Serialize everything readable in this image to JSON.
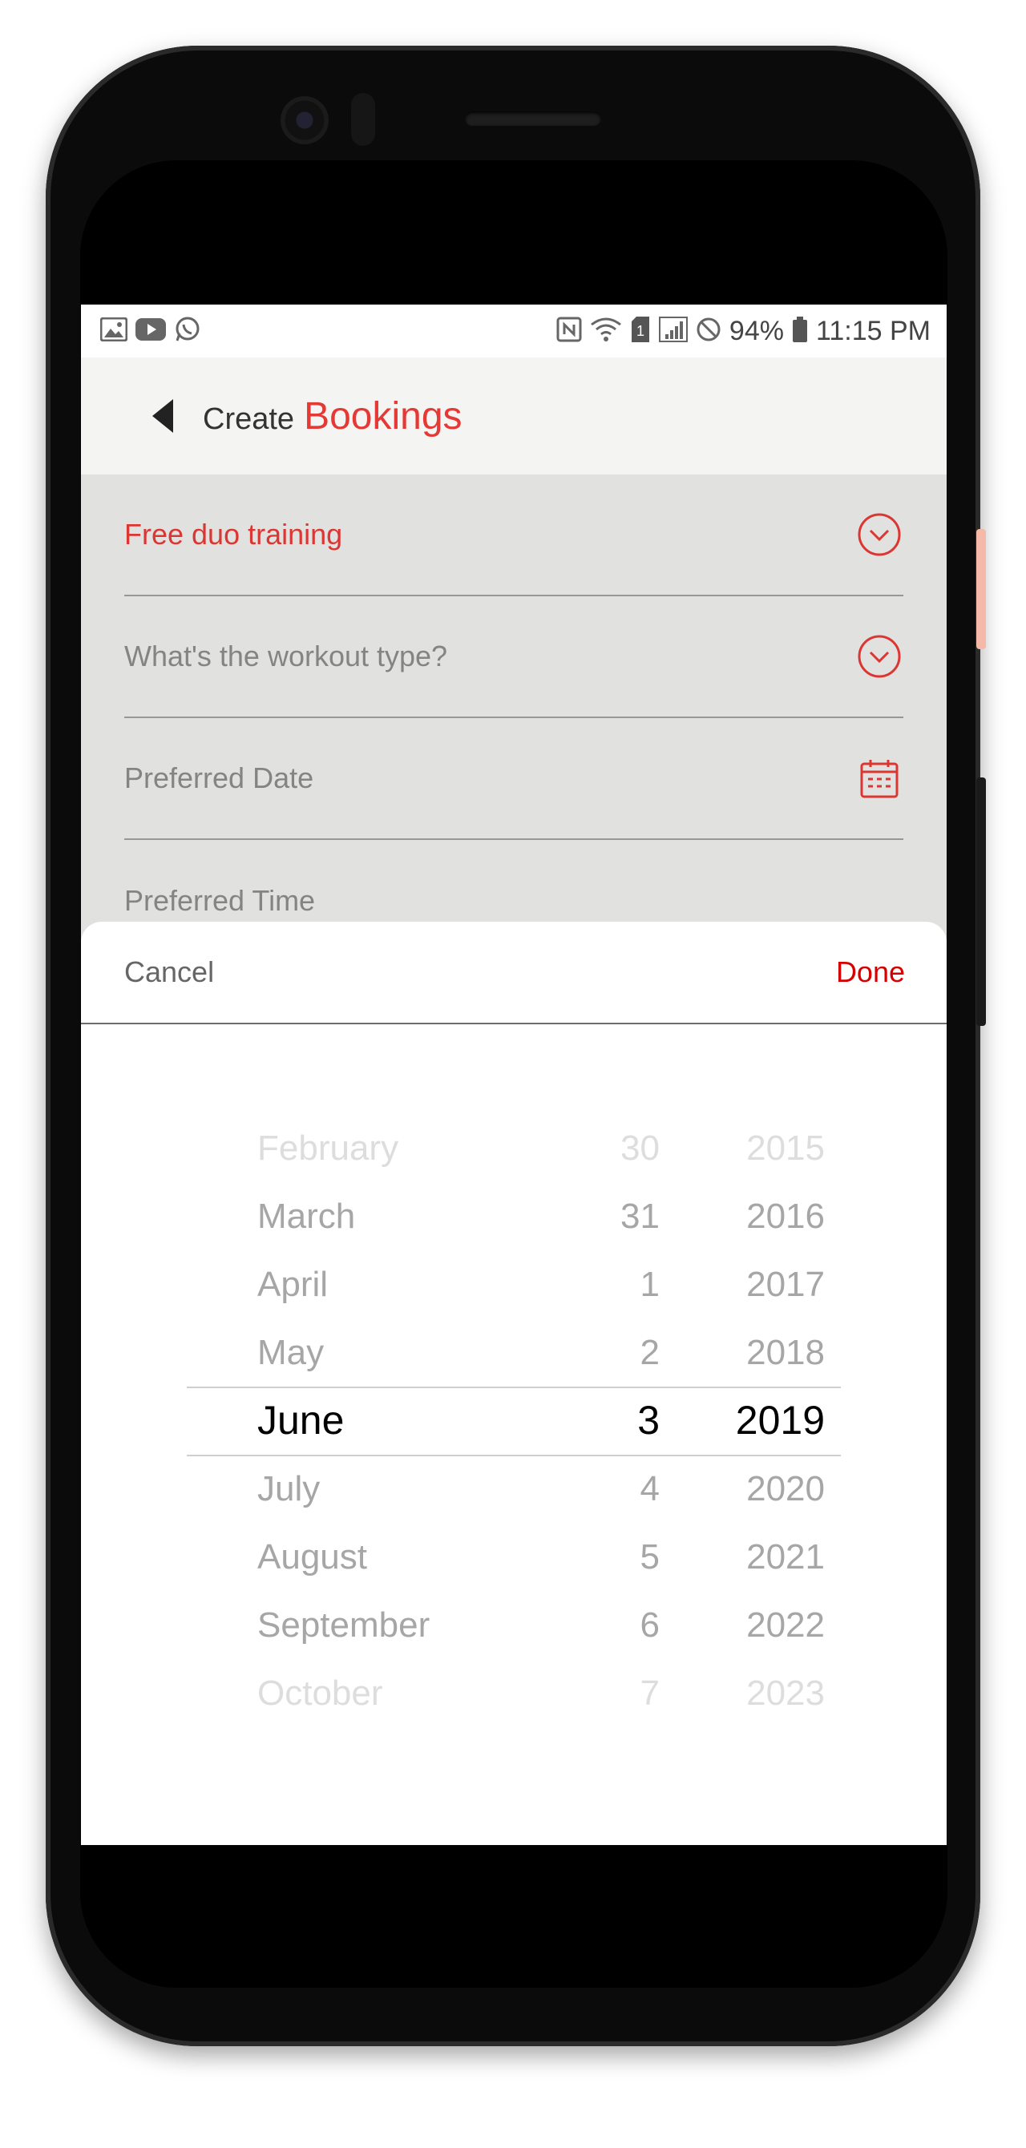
{
  "status_bar": {
    "left_icons": [
      "image-icon",
      "youtube-icon",
      "whatsapp-icon"
    ],
    "right_icons": [
      "nfc-icon",
      "wifi-icon",
      "sim-icon",
      "signal-icon",
      "dnd-icon",
      "battery-icon"
    ],
    "battery": "94%",
    "time": "11:15 PM"
  },
  "header": {
    "title_prefix": "Create",
    "title_accent": "Bookings",
    "accent_color": "#e53935"
  },
  "form": {
    "program": "Free duo training",
    "workout_type_placeholder": "What's the workout type?",
    "date_placeholder": "Preferred Date",
    "time_placeholder": "Preferred Time"
  },
  "sheet": {
    "cancel_label": "Cancel",
    "done_label": "Done",
    "done_color": "#d50000"
  },
  "picker": {
    "months": [
      "February",
      "March",
      "April",
      "May",
      "June",
      "July",
      "August",
      "September",
      "October"
    ],
    "days": [
      "30",
      "31",
      "1",
      "2",
      "3",
      "4",
      "5",
      "6",
      "7"
    ],
    "years": [
      "2015",
      "2016",
      "2017",
      "2018",
      "2019",
      "2020",
      "2021",
      "2022",
      "2023"
    ],
    "selected_index": 4
  }
}
